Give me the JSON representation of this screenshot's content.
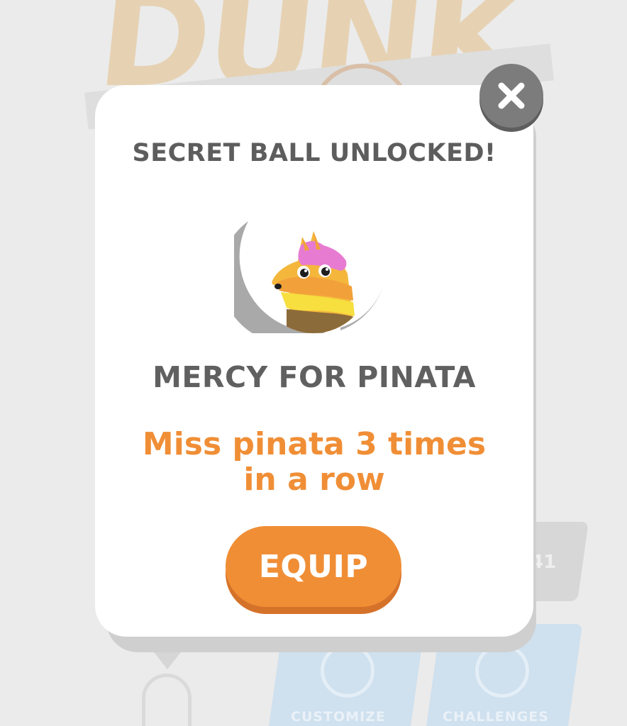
{
  "background": {
    "logo_text": "DUNK",
    "side_card_text": "41",
    "tabs": [
      {
        "label": "CUSTOMIZE"
      },
      {
        "label": "CHALLENGES"
      }
    ]
  },
  "modal": {
    "close_icon": "close-icon",
    "title": "SECRET BALL UNLOCKED!",
    "ball_icon": "pinata-llama-icon",
    "ball_name": "MERCY FOR PINATA",
    "description": "Miss pinata 3 times in a row",
    "equip_label": "EQUIP"
  },
  "colors": {
    "accent_orange": "#f08e36",
    "text_gray": "#5d5d5d",
    "close_gray": "#7c7c7c",
    "modal_bg": "#ffffff"
  }
}
